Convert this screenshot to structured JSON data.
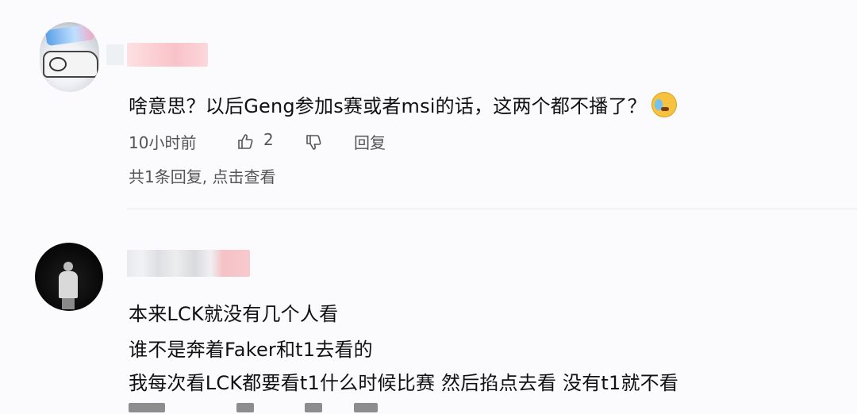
{
  "comments": [
    {
      "text_lines": [
        "啥意思？以后Geng参加s赛或者msi的话，这两个都不播了？"
      ],
      "emoji": "crying-face-emoji",
      "time": "10小时前",
      "likes": "2",
      "reply_label": "回复",
      "replies_link": "共1条回复, 点击查看"
    },
    {
      "text_lines": [
        "本来LCK就没有几个人看",
        "谁不是奔着Faker和t1去看的",
        "我每次看LCK都要看t1什么时候比赛 然后掐点去看 没有t1就不看"
      ]
    }
  ],
  "colors": {
    "text": "#111111",
    "meta": "#555555",
    "divider": "#e6e7ea",
    "background": "#fbfbfd"
  }
}
